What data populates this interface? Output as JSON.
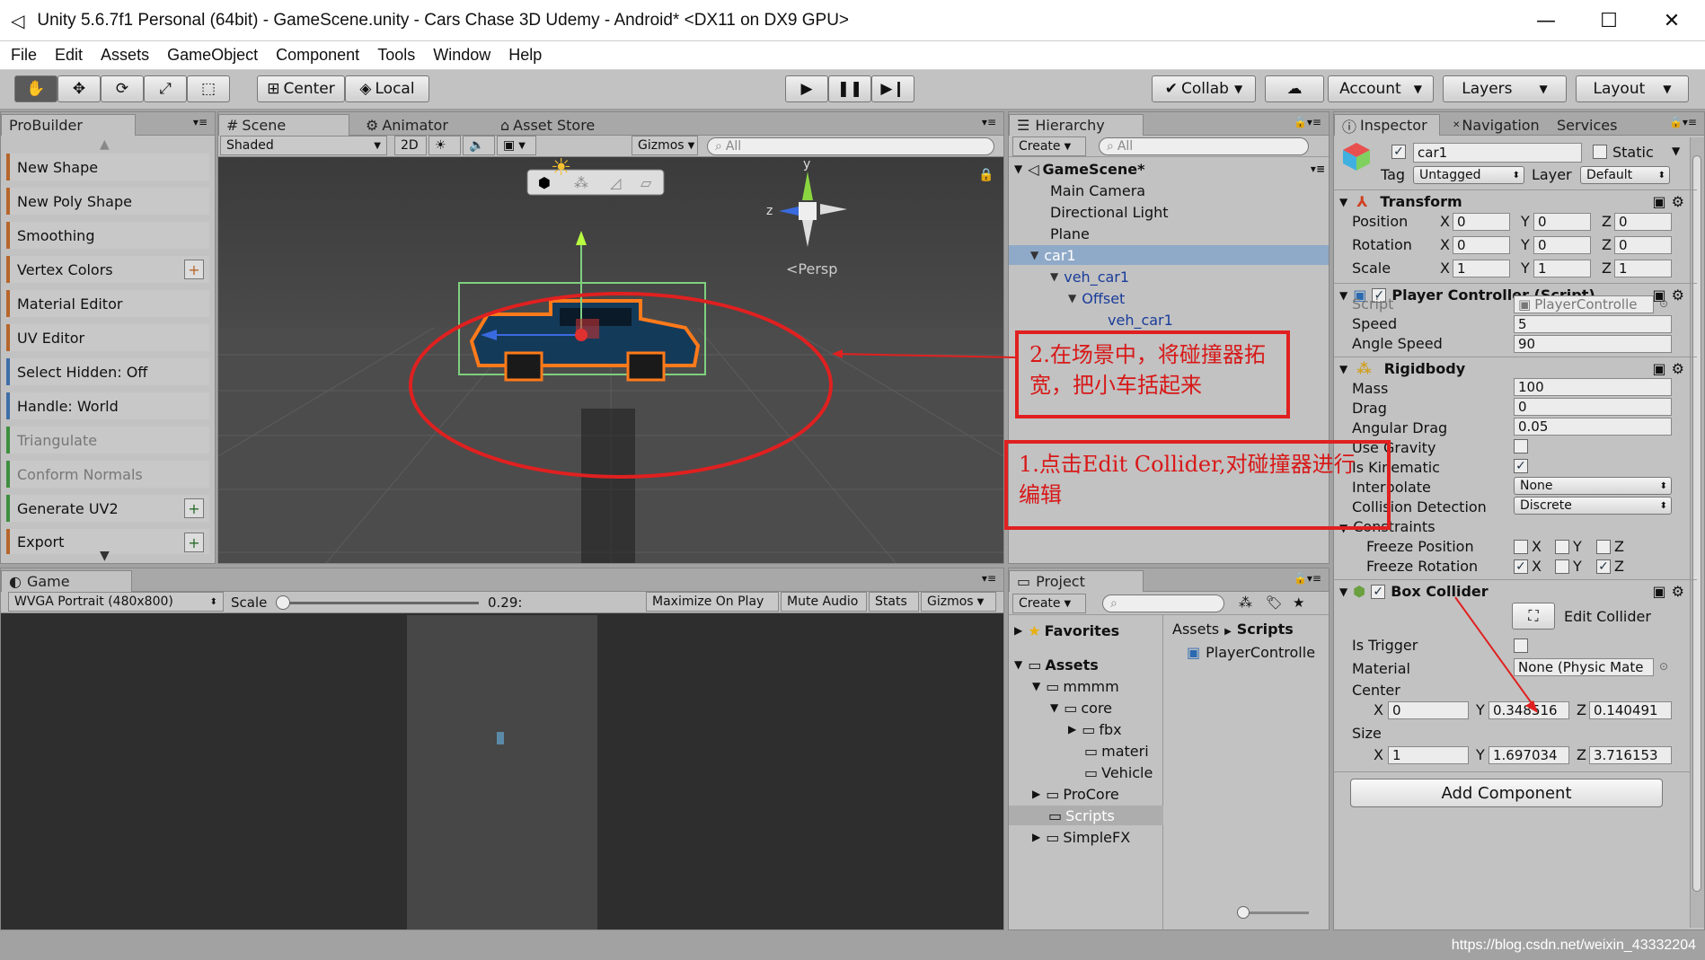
{
  "window": {
    "title": "Unity 5.6.7f1 Personal (64bit) - GameScene.unity - Cars Chase 3D Udemy - Android* <DX11 on DX9 GPU>",
    "minimize": "—",
    "maximize": "☐",
    "close": "✕"
  },
  "menu": [
    "File",
    "Edit",
    "Assets",
    "GameObject",
    "Component",
    "Tools",
    "Window",
    "Help"
  ],
  "toolbar": {
    "center": "Center",
    "local": "Local",
    "collab": "Collab",
    "account": "Account",
    "layers": "Layers",
    "layout": "Layout"
  },
  "probuilder": {
    "tab": "ProBuilder",
    "items": [
      {
        "label": "New Shape"
      },
      {
        "label": "New Poly Shape"
      },
      {
        "label": "Smoothing"
      },
      {
        "label": "Vertex Colors",
        "plus": "+"
      },
      {
        "label": "Material Editor"
      },
      {
        "label": "UV Editor"
      },
      {
        "label": "Select Hidden: Off"
      },
      {
        "label": "Handle: World"
      },
      {
        "label": "Triangulate"
      },
      {
        "label": "Conform Normals"
      },
      {
        "label": "Generate UV2",
        "plus": "+"
      },
      {
        "label": "Export",
        "plus": "+"
      }
    ]
  },
  "scene": {
    "tabs": [
      "Scene",
      "Animator",
      "Asset Store"
    ],
    "shaded": "Shaded",
    "twod": "2D",
    "gizmos": "Gizmos",
    "search_placeholder": "All",
    "persp": "Persp",
    "axis_y": "y",
    "axis_z": "z"
  },
  "game": {
    "tab": "Game",
    "resolution": "WVGA Portrait (480x800)",
    "scale_label": "Scale",
    "scale_value": "0.29:",
    "maximize": "Maximize On Play",
    "mute": "Mute Audio",
    "stats": "Stats",
    "gizmos": "Gizmos"
  },
  "hierarchy": {
    "tab": "Hierarchy",
    "create": "Create",
    "search_placeholder": "All",
    "scene": "GameScene*",
    "items": [
      "Main Camera",
      "Directional Light",
      "Plane",
      "car1",
      "veh_car1",
      "Offset",
      "veh_car1"
    ]
  },
  "project": {
    "tab": "Project",
    "create": "Create",
    "favorites": "Favorites",
    "breadcrumb_root": "Assets",
    "breadcrumb_leaf": "Scripts",
    "file": "PlayerControlle",
    "tree": [
      "Assets",
      "mmmm",
      "core",
      "fbx",
      "materi",
      "Vehicle",
      "ProCore",
      "Scripts",
      "SimpleFX"
    ]
  },
  "inspector": {
    "tabs": [
      "Inspector",
      "Navigation",
      "Services"
    ],
    "name": "car1",
    "static": "Static",
    "tag_label": "Tag",
    "tag_value": "Untagged",
    "layer_label": "Layer",
    "layer_value": "Default",
    "transform": {
      "title": "Transform",
      "rows": [
        {
          "label": "Position",
          "x": "0",
          "y": "0",
          "z": "0"
        },
        {
          "label": "Rotation",
          "x": "0",
          "y": "0",
          "z": "0"
        },
        {
          "label": "Scale",
          "x": "1",
          "y": "1",
          "z": "1"
        }
      ]
    },
    "player": {
      "title": "Player Controller (Script)",
      "script_label": "Script",
      "script_value": "PlayerControlle",
      "speed_label": "Speed",
      "speed_value": "5",
      "angle_label": "Angle Speed",
      "angle_value": "90"
    },
    "rigidbody": {
      "title": "Rigidbody",
      "mass_label": "Mass",
      "mass": "100",
      "drag_label": "Drag",
      "drag": "0",
      "adrag_label": "Angular Drag",
      "adrag": "0.05",
      "gravity_label": "Use Gravity",
      "kinematic_label": "Is Kinematic",
      "kinematic_check": "✓",
      "interp_label": "Interpolate",
      "interp": "None",
      "coll_label": "Collision Detection",
      "coll": "Discrete",
      "constraints_label": "Constraints",
      "freeze_pos": "Freeze Position",
      "freeze_rot": "Freeze Rotation",
      "x": "X",
      "y": "Y",
      "z": "Z"
    },
    "box": {
      "title": "Box Collider",
      "edit": "Edit Collider",
      "trigger_label": "Is Trigger",
      "material_label": "Material",
      "material": "None (Physic Mate",
      "center_label": "Center",
      "cx": "0",
      "cy": "0.348516",
      "cz": "0.140491",
      "size_label": "Size",
      "sx": "1",
      "sy": "1.697034",
      "sz": "3.716153"
    },
    "add_component": "Add Component"
  },
  "annotations": {
    "a1": "1.点击Edit Collider,对碰撞器进行编辑",
    "a2": "2.在场景中，将碰撞器拓宽，把小车括起来"
  },
  "watermark": "https://blog.csdn.net/weixin_43332204",
  "colors": {
    "annotation": "#e02020",
    "selection": "#8fa9c8",
    "toolbar": "#c2c2c2"
  }
}
